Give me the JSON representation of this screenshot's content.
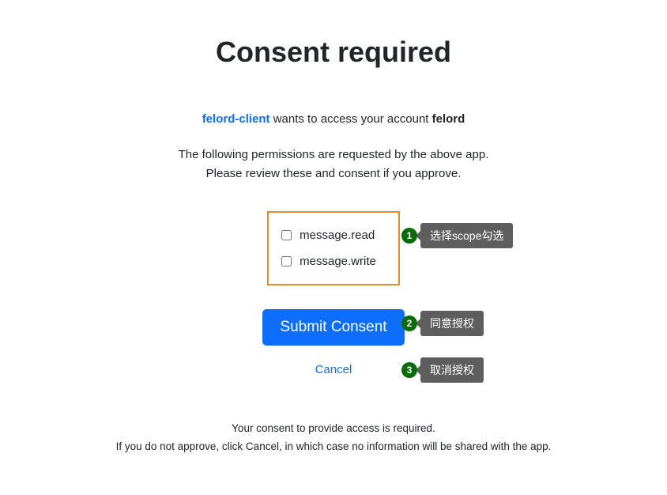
{
  "heading": "Consent required",
  "intro": {
    "client_name": "felord-client",
    "middle_text": " wants to access your account ",
    "account_name": "felord"
  },
  "description_line1": "The following permissions are requested by the above app.",
  "description_line2": "Please review these and consent if you approve.",
  "scopes": [
    {
      "label": "message.read"
    },
    {
      "label": "message.write"
    }
  ],
  "submit_label": "Submit Consent",
  "cancel_label": "Cancel",
  "footer_line1": "Your consent to provide access is required.",
  "footer_line2": "If you do not approve, click Cancel, in which case no information will be shared with the app.",
  "annotations": [
    {
      "num": "1",
      "text": "选择scope勾选"
    },
    {
      "num": "2",
      "text": "同意授权"
    },
    {
      "num": "3",
      "text": "取消授权"
    }
  ]
}
